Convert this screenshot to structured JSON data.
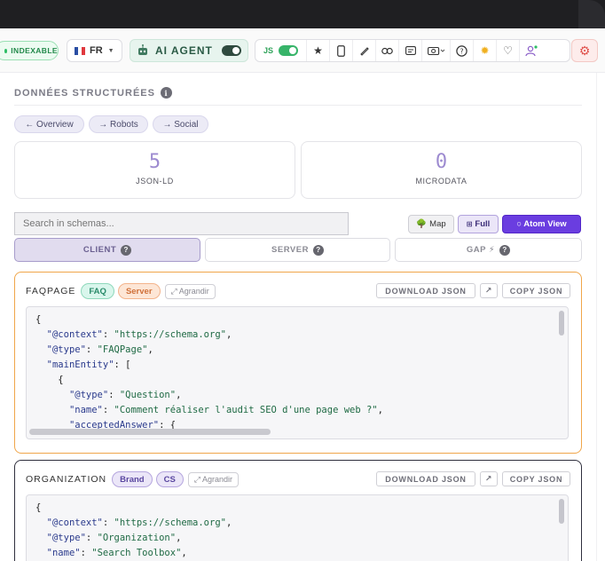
{
  "toolbar": {
    "indexable": "INDEXABLE",
    "language": "FR",
    "ai_agent": "AI AGENT",
    "js_label": "JS",
    "icons": [
      "star-icon",
      "mobile-icon",
      "pen-icon",
      "link-icon",
      "text-icon",
      "camera-icon",
      "help-icon",
      "sun-icon",
      "heart-icon",
      "user-icon",
      "gear-icon"
    ],
    "colors": {
      "indexable": "#22894a",
      "settings": "#e0504b",
      "accent": "#6a3de0"
    }
  },
  "section": {
    "title": "DONNÉES STRUCTURÉES",
    "nav": [
      "← Overview",
      "→ Robots",
      "→ Social"
    ]
  },
  "stats": [
    {
      "value": "5",
      "label": "JSON-LD"
    },
    {
      "value": "0",
      "label": "MICRODATA"
    }
  ],
  "search": {
    "placeholder": "Search in schemas..."
  },
  "views": {
    "map": "Map",
    "full": "Full",
    "atom": "○ Atom View"
  },
  "tabs": {
    "client": "CLIENT",
    "server": "SERVER",
    "gap": "GAP ⚡"
  },
  "cards": [
    {
      "title": "FAQPAGE",
      "badges": [
        "FAQ",
        "Server"
      ],
      "expand": "⤢ Agrandir",
      "download": "DOWNLOAD JSON",
      "open": "↗",
      "copy": "COPY JSON",
      "code": [
        "{",
        "  \"@context\": \"https://schema.org\",",
        "  \"@type\": \"FAQPage\",",
        "  \"mainEntity\": [",
        "    {",
        "      \"@type\": \"Question\",",
        "      \"name\": \"Comment réaliser l'audit SEO d'une page web ?\",",
        "      \"acceptedAnswer\": {"
      ]
    },
    {
      "title": "ORGANIZATION",
      "badges": [
        "Brand",
        "CS"
      ],
      "expand": "⤢ Agrandir",
      "download": "DOWNLOAD JSON",
      "open": "↗",
      "copy": "COPY JSON",
      "code": [
        "{",
        "  \"@context\": \"https://schema.org\",",
        "  \"@type\": \"Organization\",",
        "  \"name\": \"Search Toolbox\","
      ]
    }
  ]
}
